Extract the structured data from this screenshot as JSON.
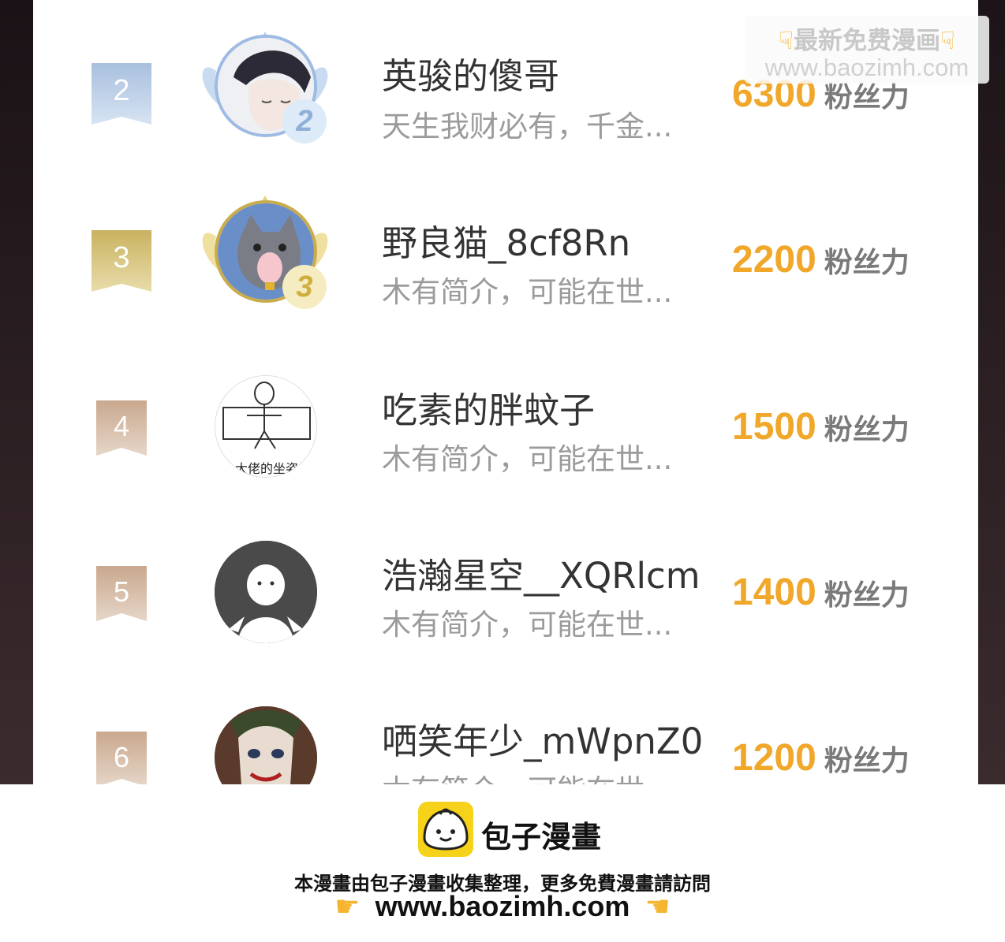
{
  "ranking": [
    {
      "rank": "2",
      "name": "英骏的傻哥",
      "bio": "天生我财必有，千金...",
      "fans": "6300",
      "fans_label": "粉丝力",
      "badge": "2",
      "rank_color": "#b8cde6",
      "badge_color": "#8eb0d8",
      "avatar_icon": "anime-boy-avatar"
    },
    {
      "rank": "3",
      "name": "野良猫_8cf8Rn",
      "bio": "木有简介，可能在世...",
      "fans": "2200",
      "fans_label": "粉丝力",
      "badge": "3",
      "rank_color": "#d6c27a",
      "badge_color": "#d9c064",
      "avatar_icon": "cat-avatar"
    },
    {
      "rank": "4",
      "name": "吃素的胖蚊子",
      "bio": "木有简介，可能在世...",
      "fans": "1500",
      "fans_label": "粉丝力",
      "rank_color": "#d3b9a5",
      "avatar_icon": "sketch-meme-avatar",
      "avatar_text": "大佬的坐姿"
    },
    {
      "rank": "5",
      "name": "浩瀚星空__XQRlcm",
      "bio": "木有简介，可能在世...",
      "fans": "1400",
      "fans_label": "粉丝力",
      "rank_color": "#d3b9a5",
      "avatar_icon": "default-user-avatar"
    },
    {
      "rank": "6",
      "name": "哂笑年少_mWpnZ0",
      "bio": "木有简介，可能在世...",
      "fans": "1200",
      "fans_label": "粉丝力",
      "rank_color": "#d3b9a5",
      "avatar_icon": "joker-avatar"
    }
  ],
  "watermark": {
    "title": "最新免费漫画",
    "url": "www.baozimh.com",
    "hand_icon": "pointing-down-hand-icon"
  },
  "footer": {
    "brand": "包子漫畫",
    "logo_icon": "baozi-logo-icon",
    "note": "本漫畫由包子漫畫收集整理，更多免費漫畫請訪問",
    "url": "www.baozimh.com",
    "hand_icon": "pointing-hand-icon"
  },
  "colors": {
    "accent": "#f0a72a",
    "logo_yellow": "#f7d21a"
  }
}
